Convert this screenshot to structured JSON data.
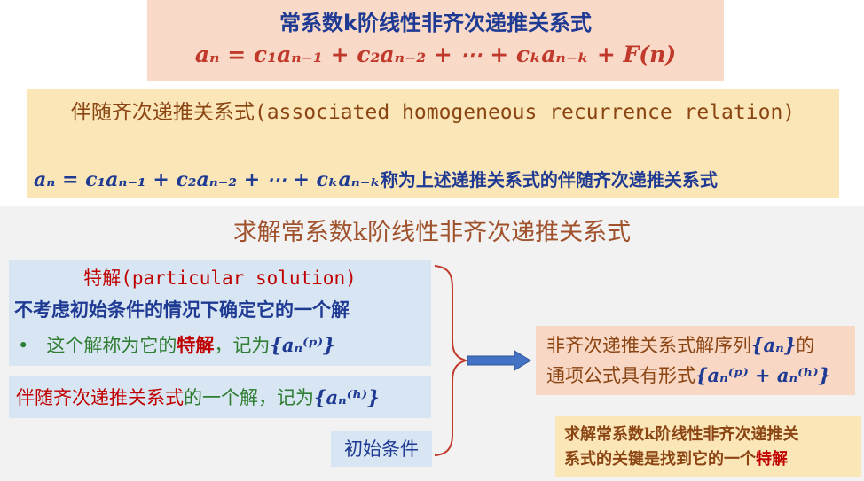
{
  "box1": {
    "title": "常系数k阶线性非齐次递推关系式",
    "formula": "aₙ = c₁aₙ₋₁ + c₂aₙ₋₂ + ⋯ + cₖaₙ₋ₖ + F(n)"
  },
  "box2": {
    "title_cn": "伴随齐次递推关系式",
    "title_en": "(associated homogeneous recurrence relation)",
    "formula": "aₙ = c₁aₙ₋₁ + c₂aₙ₋₂ + ⋯ + cₖaₙ₋ₖ",
    "formula_text": "称为上述递推关系式的伴随齐次递推关系式"
  },
  "section": {
    "title": "求解常系数k阶线性非齐次递推关系式"
  },
  "particular": {
    "heading_cn": "特解",
    "heading_en": "(particular solution)",
    "line2": "不考虑初始条件的情况下确定它的一个解",
    "bullet_pre": "这个解称为它的",
    "bullet_red": "特解",
    "bullet_post": "，记为",
    "bullet_math": "{aₙ⁽ᵖ⁾}"
  },
  "homogeneous": {
    "red": "伴随齐次递推关系式",
    "post": "的一个解，记为",
    "math": "{aₙ⁽ʰ⁾}"
  },
  "initial": {
    "label": "初始条件"
  },
  "result": {
    "line1_pre": "非齐次递推关系式解序列",
    "line1_math": "{aₙ}",
    "line1_post": "的",
    "line2_pre": "通项公式具有形式",
    "line2_math": "{aₙ⁽ᵖ⁾ + aₙ⁽ʰ⁾}"
  },
  "key": {
    "line1": "求解常系数k阶线性非齐次递推关",
    "line2_pre": "系式的关键是找到它的一个",
    "line2_red": "特解"
  }
}
